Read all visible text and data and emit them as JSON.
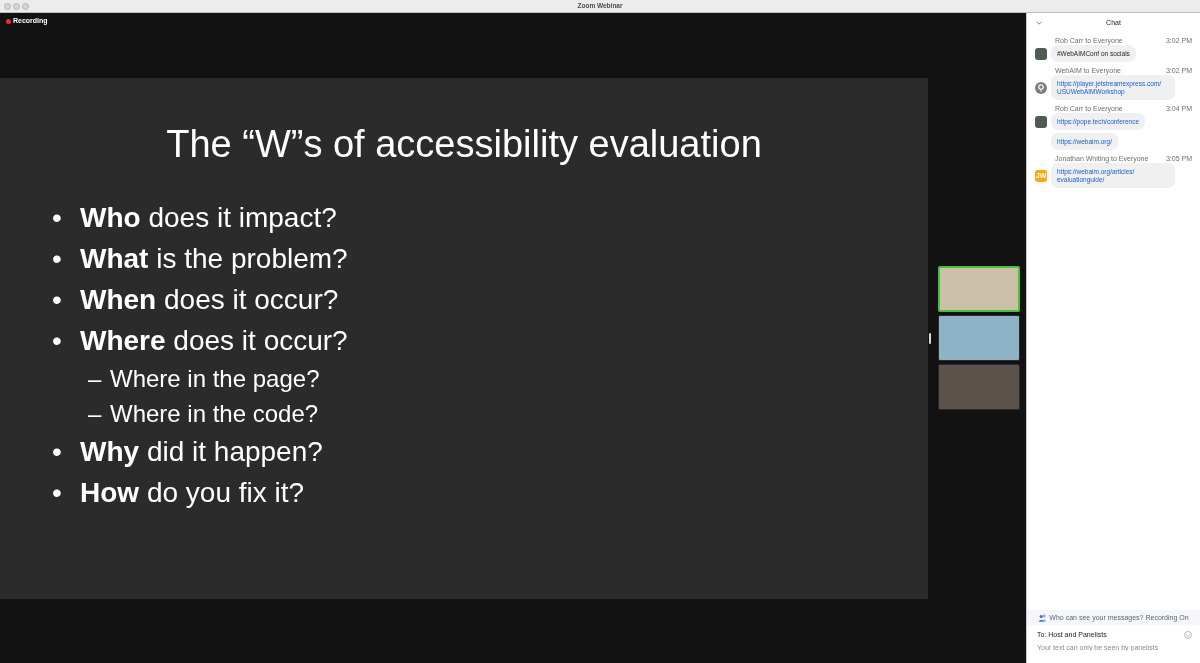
{
  "window": {
    "title": "Zoom Webinar"
  },
  "recording": {
    "label": "Recording"
  },
  "slide": {
    "title": "The “W”s of accessibility evaluation",
    "bullets": [
      {
        "marker": "•",
        "text": "**Who** does it impact?"
      },
      {
        "marker": "•",
        "text": "**What** is the problem?"
      },
      {
        "marker": "•",
        "text": "**When** does it occur?"
      },
      {
        "marker": "•",
        "text": "**Where** does it occur?",
        "children": [
          {
            "marker": "–",
            "text": "Where in the page?"
          },
          {
            "marker": "–",
            "text": "Where in the code?"
          }
        ]
      },
      {
        "marker": "•",
        "text": "**Why** did it happen?"
      },
      {
        "marker": "•",
        "text": "**How** do you fix it?"
      }
    ]
  },
  "videos": [
    {
      "speaking": true
    },
    {
      "speaking": false
    },
    {
      "speaking": false
    }
  ],
  "chat": {
    "title": "Chat",
    "messages": [
      {
        "sender": "Rob Carr to Everyone",
        "time": "3:02 PM",
        "avatar": {
          "kind": "photo"
        },
        "bubbles": [
          {
            "kind": "text",
            "text": "#WebAIMConf on socials"
          }
        ]
      },
      {
        "sender": "WebAIM to Everyone",
        "time": "3:02 PM",
        "avatar": {
          "kind": "icon"
        },
        "bubbles": [
          {
            "kind": "link",
            "text": "https://player.jetstreamexpress.com/USUWebAIMWorkshop"
          }
        ]
      },
      {
        "sender": "Rob Carr to Everyone",
        "time": "3:04 PM",
        "avatar": {
          "kind": "photo"
        },
        "bubbles": [
          {
            "kind": "link",
            "text": "https://pope.tech/conference"
          },
          {
            "kind": "link",
            "text": "https://webaim.org/"
          }
        ]
      },
      {
        "sender": "Jonathan Whiting to Everyone",
        "time": "3:05 PM",
        "avatar": {
          "kind": "initials",
          "text": "JW"
        },
        "bubbles": [
          {
            "kind": "link",
            "text": "https://webaim.org/articles/evaluationguide/"
          }
        ]
      }
    ],
    "notice": "Who can see your messages? Recording On",
    "recipient": "To: Host and Panelists",
    "input": {
      "placeholder": "Your text can only be seen by panelists"
    }
  }
}
